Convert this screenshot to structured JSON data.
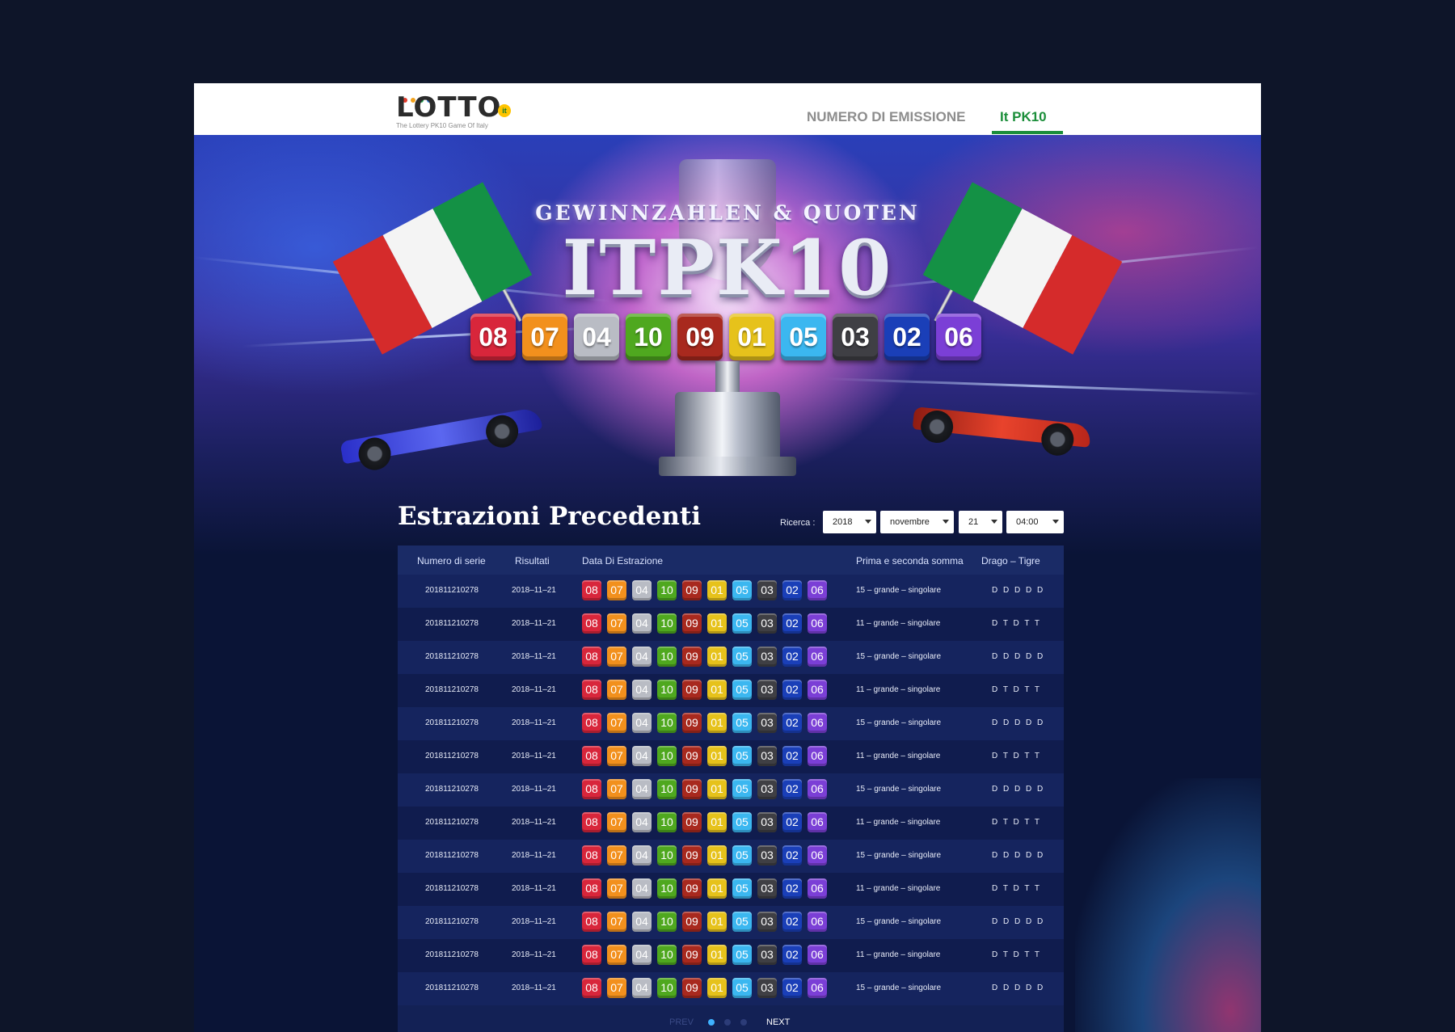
{
  "header": {
    "logo_text": "LOTTO",
    "logo_badge": "it",
    "logo_tagline": "The Lottery PK10 Game Of Italy",
    "nav": [
      {
        "label": "NUMERO DI EMISSIONE",
        "active": false
      },
      {
        "label": "It PK10",
        "active": true
      }
    ]
  },
  "hero": {
    "subtitle": "GEWINNZAHLEN & QUOTEN",
    "title": "ITPK10",
    "numbers": [
      "08",
      "07",
      "04",
      "10",
      "09",
      "01",
      "05",
      "03",
      "02",
      "06"
    ]
  },
  "ball_colors": {
    "01": "#e6c21b",
    "02": "#1a3fb8",
    "03": "#3f3f44",
    "04": "#b9bcc4",
    "05": "#3bb7f0",
    "06": "#7b3fd6",
    "07": "#f2901d",
    "08": "#d8263b",
    "09": "#a8291e",
    "10": "#4fa81f"
  },
  "history": {
    "title": "Estrazioni Precedenti",
    "search": {
      "label": "Ricerca :",
      "year": "2018",
      "month": "novembre",
      "day": "21",
      "time": "04:00"
    },
    "columns": [
      "Numero di serie",
      "Risultati",
      "Data Di Estrazione",
      "Prima e seconda somma",
      "Drago – Tigre"
    ],
    "rows": [
      {
        "serial": "201811210278",
        "date": "2018–11–21",
        "numbers": [
          "08",
          "07",
          "04",
          "10",
          "09",
          "01",
          "05",
          "03",
          "02",
          "06"
        ],
        "sum": "15 – grande – singolare",
        "dragon_tiger": "D D D D D"
      },
      {
        "serial": "201811210278",
        "date": "2018–11–21",
        "numbers": [
          "08",
          "07",
          "04",
          "10",
          "09",
          "01",
          "05",
          "03",
          "02",
          "06"
        ],
        "sum": "11 – grande – singolare",
        "dragon_tiger": "D T D T T"
      },
      {
        "serial": "201811210278",
        "date": "2018–11–21",
        "numbers": [
          "08",
          "07",
          "04",
          "10",
          "09",
          "01",
          "05",
          "03",
          "02",
          "06"
        ],
        "sum": "15 – grande – singolare",
        "dragon_tiger": "D D D D D"
      },
      {
        "serial": "201811210278",
        "date": "2018–11–21",
        "numbers": [
          "08",
          "07",
          "04",
          "10",
          "09",
          "01",
          "05",
          "03",
          "02",
          "06"
        ],
        "sum": "11 – grande – singolare",
        "dragon_tiger": "D T D T T"
      },
      {
        "serial": "201811210278",
        "date": "2018–11–21",
        "numbers": [
          "08",
          "07",
          "04",
          "10",
          "09",
          "01",
          "05",
          "03",
          "02",
          "06"
        ],
        "sum": "15 – grande – singolare",
        "dragon_tiger": "D D D D D"
      },
      {
        "serial": "201811210278",
        "date": "2018–11–21",
        "numbers": [
          "08",
          "07",
          "04",
          "10",
          "09",
          "01",
          "05",
          "03",
          "02",
          "06"
        ],
        "sum": "11 – grande – singolare",
        "dragon_tiger": "D T D T T"
      },
      {
        "serial": "201811210278",
        "date": "2018–11–21",
        "numbers": [
          "08",
          "07",
          "04",
          "10",
          "09",
          "01",
          "05",
          "03",
          "02",
          "06"
        ],
        "sum": "15 – grande – singolare",
        "dragon_tiger": "D D D D D"
      },
      {
        "serial": "201811210278",
        "date": "2018–11–21",
        "numbers": [
          "08",
          "07",
          "04",
          "10",
          "09",
          "01",
          "05",
          "03",
          "02",
          "06"
        ],
        "sum": "11 – grande – singolare",
        "dragon_tiger": "D T D T T"
      },
      {
        "serial": "201811210278",
        "date": "2018–11–21",
        "numbers": [
          "08",
          "07",
          "04",
          "10",
          "09",
          "01",
          "05",
          "03",
          "02",
          "06"
        ],
        "sum": "15 – grande – singolare",
        "dragon_tiger": "D D D D D"
      },
      {
        "serial": "201811210278",
        "date": "2018–11–21",
        "numbers": [
          "08",
          "07",
          "04",
          "10",
          "09",
          "01",
          "05",
          "03",
          "02",
          "06"
        ],
        "sum": "11 – grande – singolare",
        "dragon_tiger": "D T D T T"
      },
      {
        "serial": "201811210278",
        "date": "2018–11–21",
        "numbers": [
          "08",
          "07",
          "04",
          "10",
          "09",
          "01",
          "05",
          "03",
          "02",
          "06"
        ],
        "sum": "15 – grande – singolare",
        "dragon_tiger": "D D D D D"
      },
      {
        "serial": "201811210278",
        "date": "2018–11–21",
        "numbers": [
          "08",
          "07",
          "04",
          "10",
          "09",
          "01",
          "05",
          "03",
          "02",
          "06"
        ],
        "sum": "11 – grande – singolare",
        "dragon_tiger": "D T D T T"
      },
      {
        "serial": "201811210278",
        "date": "2018–11–21",
        "numbers": [
          "08",
          "07",
          "04",
          "10",
          "09",
          "01",
          "05",
          "03",
          "02",
          "06"
        ],
        "sum": "15 – grande – singolare",
        "dragon_tiger": "D D D D D"
      }
    ],
    "pagination": {
      "prev_label": "PREV",
      "next_label": "NEXT",
      "pages": 3,
      "current": 1
    }
  }
}
